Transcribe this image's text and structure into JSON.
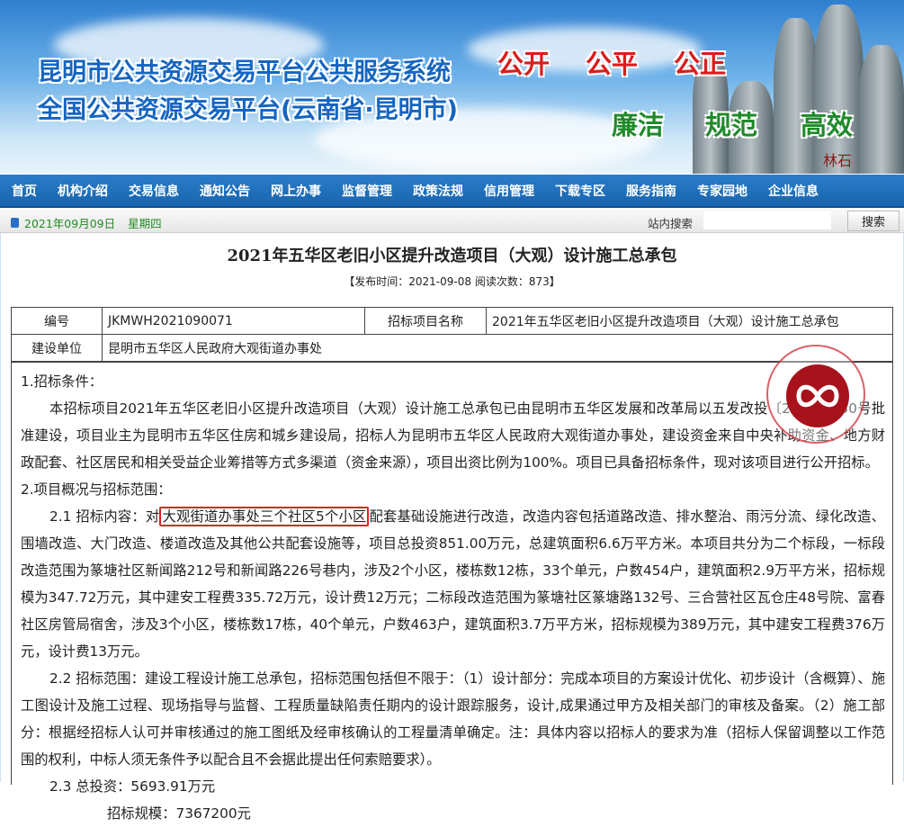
{
  "banner": {
    "title1": "昆明市公共资源交易平台公共服务系统",
    "title2": "全国公共资源交易平台(云南省·昆明市)",
    "slogans_red": [
      "公开",
      "公平",
      "公正"
    ],
    "slogans_green": [
      "廉洁",
      "规范",
      "高效"
    ],
    "stone_label": "林石"
  },
  "nav": [
    "首页",
    "机构介绍",
    "交易信息",
    "通知公告",
    "网上办事",
    "监督管理",
    "政策法规",
    "信用管理",
    "下载专区",
    "服务指南",
    "专家园地",
    "企业信息"
  ],
  "datebar": {
    "date": "2021年09月09日",
    "weekday": "星期四",
    "search_label": "站内搜索",
    "search_value": "",
    "search_button": "搜索"
  },
  "article": {
    "title": "2021年五华区老旧小区提升改造项目（大观）设计施工总承包",
    "meta": "【发布时间：2021-09-08  阅读次数：873】",
    "table": {
      "code_label": "编号",
      "code": "JKMWH2021090071",
      "project_label": "招标项目名称",
      "project": "2021年五华区老旧小区提升改造项目（大观）设计施工总承包",
      "unit_label": "建设单位",
      "unit": "昆明市五华区人民政府大观街道办事处"
    },
    "s1_heading": "1.招标条件：",
    "s1_text": "本招标项目2021年五华区老旧小区提升改造项目（大观）设计施工总承包已由昆明市五华区发展和改革局以五发改投〔2021〕130号批准建设，项目业主为昆明市五华区住房和城乡建设局，招标人为昆明市五华区人民政府大观街道办事处，建设资金来自中央补助资金、地方财政配套、社区居民和相关受益企业筹措等方式多渠道（资金来源），项目出资比例为100%。项目已具备招标条件，现对该项目进行公开招标。",
    "s2_heading": "2.项目概况与招标范围：",
    "s21_prefix": "2.1 招标内容：对",
    "s21_highlight": "大观街道办事处三个社区5个小区",
    "s21_text": "配套基础设施进行改造，改造内容包括道路改造、排水整治、雨污分流、绿化改造、围墙改造、大门改造、楼道改造及其他公共配套设施等，项目总投资851.00万元，总建筑面积6.6万平方米。本项目共分为二个标段，一标段改造范围为篆塘社区新闻路212号和新闻路226号巷内，涉及2个小区，楼栋数12栋，33个单元，户数454户，建筑面积2.9万平方米，招标规模为347.72万元，其中建安工程费335.72万元，设计费12万元；二标段改造范围为篆塘社区篆塘路132号、三合营社区瓦仓庄48号院、富春社区房管局宿舍，涉及3个小区，楼栋数17栋，40个单元，户数463户，建筑面积3.7万平方米，招标规模为389万元，其中建安工程费376万元，设计费13万元。",
    "s22_text": "2.2 招标范围：建设工程设计施工总承包，招标范围包括但不限于：（1）设计部分：完成本项目的方案设计优化、初步设计（含概算）、施工图设计及施工过程、现场指导与监督、工程质量缺陷责任期内的设计跟踪服务，设计,成果通过甲方及相关部门的审核及备案。（2）施工部分：根据经招标人认可并审核通过的施工图纸及经审核确认的工程量清单确定。注：具体内容以招标人的要求为准（招标人保留调整以工作范围的权利，中标人须无条件予以配合且不会据此提出任何索赔要求）。",
    "s23_text": "2.3 总投资：5693.91万元",
    "s23_scale": "招标规模：7367200元"
  },
  "colors": {
    "nav": "#1864ae",
    "highlight": "#e02020",
    "stamp": "#a8121c"
  }
}
